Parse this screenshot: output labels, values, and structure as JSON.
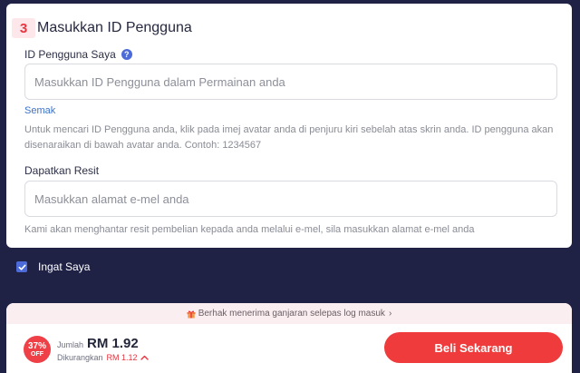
{
  "step": {
    "number": "3",
    "title": "Masukkan ID Pengguna"
  },
  "user_id": {
    "label": "ID Pengguna Saya",
    "help_icon": "?",
    "placeholder": "Masukkan ID Pengguna dalam Permainan anda",
    "check_link": "Semak",
    "hint": "Untuk mencari ID Pengguna anda, klik pada imej avatar anda di penjuru kiri sebelah atas skrin anda. ID pengguna akan disenaraikan di bawah avatar anda. Contoh: 1234567"
  },
  "receipt": {
    "label": "Dapatkan Resit",
    "placeholder": "Masukkan alamat e-mel anda",
    "hint": "Kami akan menghantar resit pembelian kepada anda melalui e-mel, sila masukkan alamat e-mel anda"
  },
  "remember": {
    "label": "Ingat Saya",
    "checked": true
  },
  "checkout": {
    "reward_text": "Berhak menerima ganjaran selepas log masuk",
    "discount_pct": "37%",
    "discount_off": "OFF",
    "total_label": "Jumlah",
    "total_value": "RM 1.92",
    "discount_label": "Dikurangkan",
    "discount_value": "RM 1.12",
    "buy_label": "Beli Sekarang"
  },
  "colors": {
    "background": "#1f2145",
    "accent_red": "#ef3b3b",
    "link_blue": "#3c73c9",
    "checkbox_blue": "#4d6bd8"
  }
}
